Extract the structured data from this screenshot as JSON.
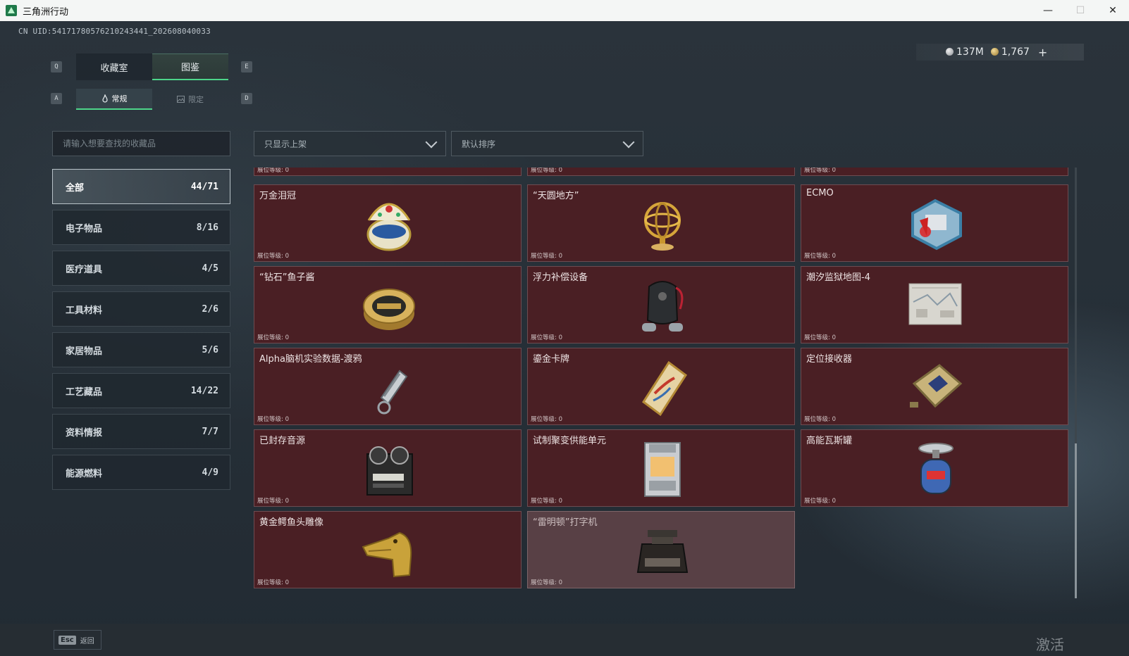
{
  "window": {
    "title": "三角洲行动",
    "minimize": "—",
    "maximize": "☐",
    "close": "✕"
  },
  "uid": "CN UID:54171780576210243441_202608040033",
  "currency": {
    "silver": "137M",
    "gold": "1,767",
    "plus": "+"
  },
  "keys": {
    "q": "Q",
    "e": "E",
    "a": "A",
    "d": "D"
  },
  "tabs": {
    "collection_room": "收藏室",
    "atlas": "图鉴"
  },
  "subtabs": {
    "normal": "常规",
    "limited": "限定"
  },
  "search": {
    "placeholder": "请输入想要查找的收藏品"
  },
  "filters": {
    "shelf_filter": "只显示上架",
    "sort": "默认排序"
  },
  "categories": [
    {
      "label": "全部",
      "count": "44/71",
      "active": true
    },
    {
      "label": "电子物品",
      "count": "8/16"
    },
    {
      "label": "医疗道具",
      "count": "4/5"
    },
    {
      "label": "工具材料",
      "count": "2/6"
    },
    {
      "label": "家居物品",
      "count": "5/6"
    },
    {
      "label": "工艺藏品",
      "count": "14/22"
    },
    {
      "label": "资料情报",
      "count": "7/7"
    },
    {
      "label": "能源燃料",
      "count": "4/9"
    }
  ],
  "level_label": "展位等级: 0",
  "items": [
    {
      "name": "",
      "level": "展位等级: 0",
      "icon": "partial-item"
    },
    {
      "name": "",
      "level": "展位等级: 0",
      "icon": "partial-item"
    },
    {
      "name": "",
      "level": "展位等级: 0",
      "icon": "partial-item"
    },
    {
      "name": "万金泪冠",
      "level": "展位等级: 0",
      "icon": "jeweled-egg-icon"
    },
    {
      "name": "“天圆地方”",
      "level": "展位等级: 0",
      "icon": "armillary-sphere-icon"
    },
    {
      "name": "ECMO",
      "level": "展位等级: 0",
      "icon": "ecmo-machine-icon"
    },
    {
      "name": "“钻石”鱼子酱",
      "level": "展位等级: 0",
      "icon": "caviar-tin-icon"
    },
    {
      "name": "浮力补偿设备",
      "level": "展位等级: 0",
      "icon": "buoyancy-device-icon"
    },
    {
      "name": "潮汐监狱地图-4",
      "level": "展位等级: 0",
      "icon": "map-icon"
    },
    {
      "name": "Alpha脑机实验数据-渡鸦",
      "level": "展位等级: 0",
      "icon": "usb-drive-icon"
    },
    {
      "name": "鎏金卡牌",
      "level": "展位等级: 0",
      "icon": "gilded-card-icon"
    },
    {
      "name": "定位接收器",
      "level": "展位等级: 0",
      "icon": "gps-receiver-icon"
    },
    {
      "name": "已封存音源",
      "level": "展位等级: 0",
      "icon": "tape-recorder-icon"
    },
    {
      "name": "试制聚变供能单元",
      "level": "展位等级: 0",
      "icon": "fusion-unit-icon"
    },
    {
      "name": "高能瓦斯罐",
      "level": "展位等级: 0",
      "icon": "gas-canister-icon"
    },
    {
      "name": "黄金鳄鱼头雕像",
      "level": "展位等级: 0",
      "icon": "crocodile-statue-icon"
    },
    {
      "name": "“雷明顿”打字机",
      "level": "展位等级: 0",
      "icon": "typewriter-icon",
      "dim": true
    }
  ],
  "footer": {
    "esc_key": "Esc",
    "esc_label": "返回"
  },
  "watermark": "激活 Windows",
  "colors": {
    "accent": "#4dd68a",
    "card_bg": "#4a1f24",
    "card_dim_bg": "#584045"
  }
}
